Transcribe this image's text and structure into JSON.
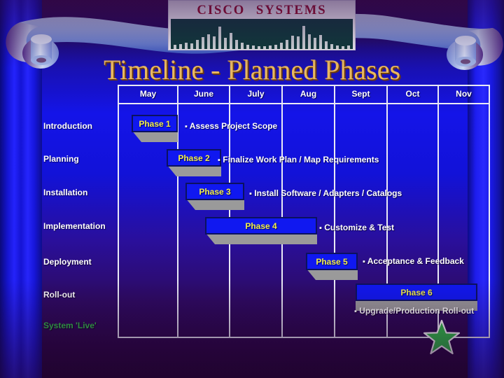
{
  "slide": {
    "title": "Timeline - Planned Phases",
    "logo": {
      "brand_cisco": "CISCO",
      "brand_systems": "SYSTEMS",
      "alt": "cisco-systems-logo"
    },
    "colors": {
      "title_gold": "#e8b860",
      "bar_blue": "#1018f0",
      "bar_text_yellow": "#f2ee4c",
      "grid_line": "#e9e9f5",
      "logo_red": "#a51226",
      "logo_teal": "#0d4038",
      "star_green": "#33c04a",
      "shadow_gray": "#9a9a9a"
    }
  },
  "timeline": {
    "months": [
      "May",
      "June",
      "July",
      "Aug",
      "Sept",
      "Oct",
      "Nov"
    ],
    "rows": [
      {
        "label": "Introduction",
        "live": false
      },
      {
        "label": "Planning",
        "live": false
      },
      {
        "label": "Installation",
        "live": false
      },
      {
        "label": "Implementation",
        "live": false
      },
      {
        "label": "Deployment",
        "live": false
      },
      {
        "label": "Roll-out",
        "live": false
      },
      {
        "label": "System 'Live'",
        "live": true
      }
    ],
    "phases": [
      {
        "name": "Phase 1",
        "note": "Assess Project Scope"
      },
      {
        "name": "Phase 2",
        "note": "Finalize Work Plan / Map Requirements"
      },
      {
        "name": "Phase 3",
        "note": "Install Software / Adapters / Catalogs"
      },
      {
        "name": "Phase 4",
        "note": "Customize & Test"
      },
      {
        "name": "Phase 5",
        "note": "Acceptance & Feedback"
      },
      {
        "name": "Phase 6",
        "note": "Upgrade/Production Roll-out"
      }
    ],
    "bullet": "▪",
    "milestone_icon": "green-star-milestone"
  },
  "chart_data": {
    "type": "bar",
    "title": "Timeline - Planned Phases",
    "xlabel": "",
    "ylabel": "",
    "categories": [
      "May",
      "June",
      "July",
      "Aug",
      "Sept",
      "Oct",
      "Nov"
    ],
    "rows": [
      "Introduction",
      "Planning",
      "Installation",
      "Implementation",
      "Deployment",
      "Roll-out",
      "System 'Live'"
    ],
    "series": [
      {
        "name": "Phase 1",
        "row": "Introduction",
        "start_month": "May",
        "end_month": "June",
        "start": 0.25,
        "end": 1.0,
        "note": "Assess Project Scope"
      },
      {
        "name": "Phase 2",
        "row": "Planning",
        "start_month": "June",
        "end_month": "July",
        "start": 1.05,
        "end": 1.8,
        "note": "Finalize Work Plan / Map Requirements"
      },
      {
        "name": "Phase 3",
        "row": "Installation",
        "start_month": "June",
        "end_month": "July",
        "start": 1.4,
        "end": 2.25,
        "note": "Install Software / Adapters / Catalogs"
      },
      {
        "name": "Phase 4",
        "row": "Implementation",
        "start_month": "July",
        "end_month": "Aug",
        "start": 1.7,
        "end": 3.8,
        "note": "Customize & Test"
      },
      {
        "name": "Phase 5",
        "row": "Deployment",
        "start_month": "Sept",
        "end_month": "Sept",
        "start": 3.65,
        "end": 4.6,
        "note": "Acceptance & Feedback"
      },
      {
        "name": "Phase 6",
        "row": "Roll-out",
        "start_month": "Oct",
        "end_month": "Nov",
        "start": 4.55,
        "end": 6.9,
        "note": "Upgrade/Production Roll-out"
      }
    ],
    "milestone": {
      "row": "System 'Live'",
      "month": "Nov",
      "marker": "star",
      "color": "#33c04a"
    },
    "grid": true,
    "legend": "none"
  }
}
